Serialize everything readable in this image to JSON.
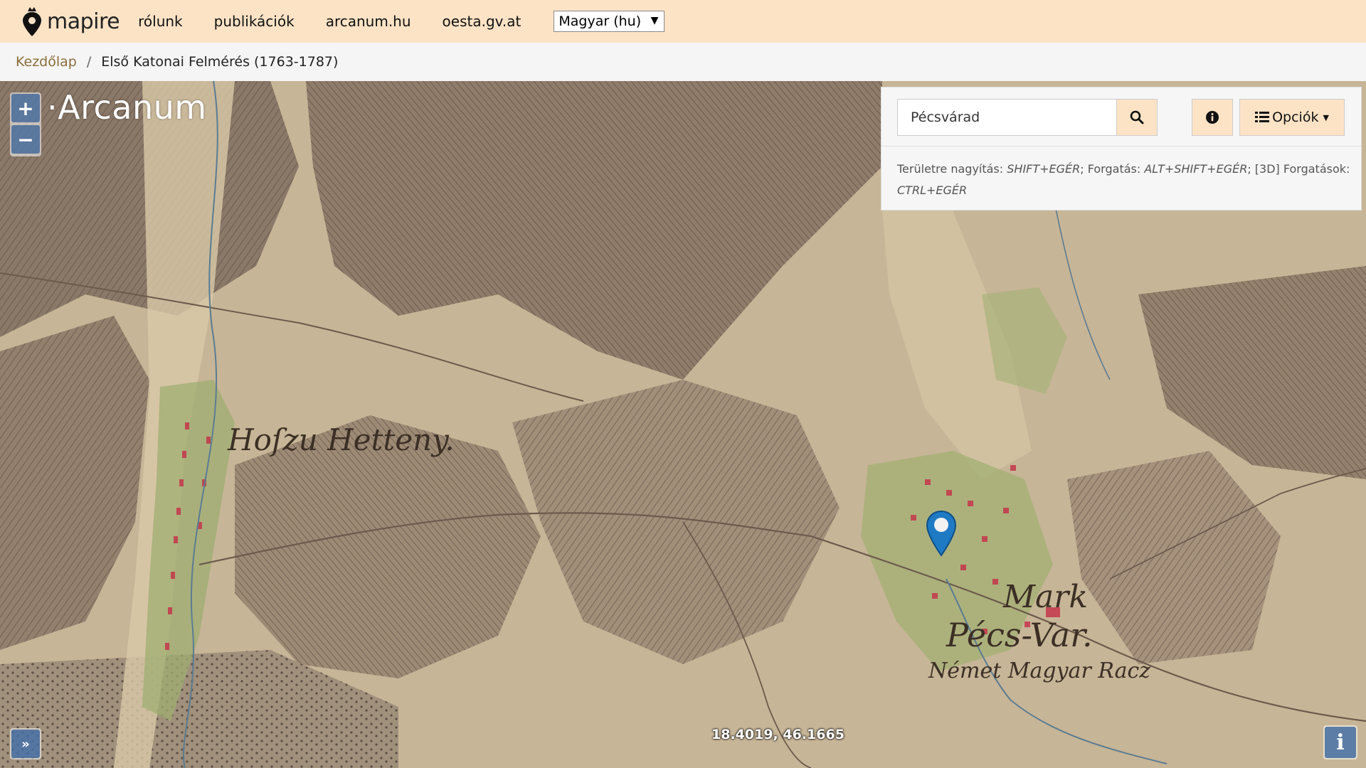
{
  "navbar": {
    "logo_text": "mapire",
    "links": [
      "rólunk",
      "publikációk",
      "arcanum.hu",
      "oesta.gv.at"
    ],
    "language": "Magyar (hu)"
  },
  "breadcrumb": {
    "home": "Kezdőlap",
    "separator": "/",
    "current": "Első Katonai Felmérés (1763-1787)"
  },
  "map": {
    "watermark": "Arcanum",
    "zoom_in": "+",
    "zoom_out": "−",
    "coordinates": "18.4019, 46.1665",
    "labels": {
      "hosszuhetteny": "Hoſzu Hetteny.",
      "mark": "Mark",
      "pecsvar": "Pécs-Var.",
      "nemet": "Német Magyar Racz"
    }
  },
  "search": {
    "value": "Pécsvárad",
    "options_label": "Opciók"
  },
  "help": {
    "zoom_area_label": "Területre nagyítás:",
    "zoom_area_keys": "SHIFT+EGÉR",
    "rotate_label": "; Forgatás:",
    "rotate_keys": "ALT+SHIFT+EGÉR",
    "rotate3d_label": "; [3D] Forgatások:",
    "rotate3d_keys": "CTRL+EGÉR"
  },
  "colors": {
    "navbar_bg": "#fde3c6",
    "marker": "#1f7ac4"
  }
}
